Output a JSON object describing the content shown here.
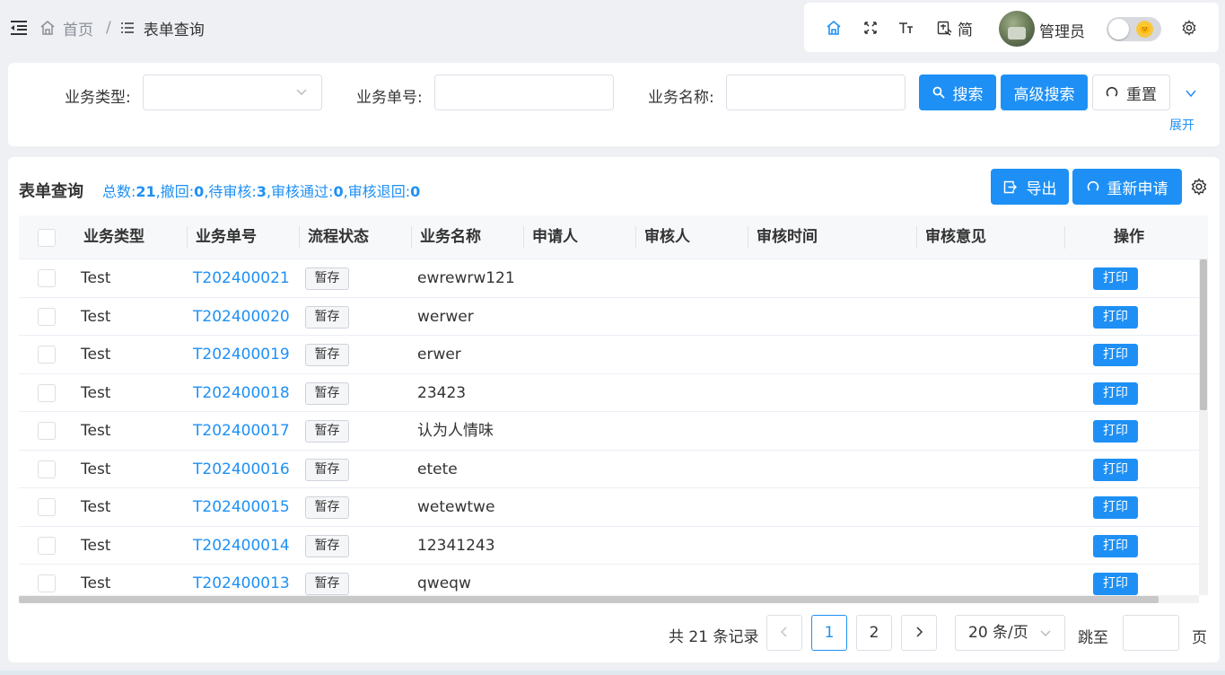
{
  "breadcrumb": {
    "home": "首页",
    "separator": "/",
    "current": "表单查询"
  },
  "toolbar": {
    "language": "简",
    "username": "管理员",
    "theme_emoji": "🌞"
  },
  "search": {
    "fields": [
      {
        "label": "业务类型:",
        "value": "",
        "placeholder": ""
      },
      {
        "label": "业务单号:",
        "value": "",
        "placeholder": ""
      },
      {
        "label": "业务名称:",
        "value": "",
        "placeholder": ""
      }
    ],
    "search_btn": "搜索",
    "advanced_btn": "高级搜索",
    "reset_btn": "重置",
    "expand_label": "展开"
  },
  "table_card": {
    "title": "表单查询",
    "stats": {
      "total_label": "总数:",
      "total": "21",
      "sep1": ",",
      "withdrawn_label": "撤回:",
      "withdrawn": "0",
      "sep2": ",",
      "pending_label": "待审核:",
      "pending": "3",
      "sep3": ",",
      "approved_label": "审核通过:",
      "approved": "0",
      "sep4": ",",
      "returned_label": "审核退回:",
      "returned": "0"
    },
    "export_btn": "导出",
    "reapply_btn": "重新申请",
    "columns": [
      "业务类型",
      "业务单号",
      "流程状态",
      "业务名称",
      "申请人",
      "审核人",
      "审核时间",
      "审核意见",
      "操作"
    ],
    "rows": [
      {
        "type": "Test",
        "no": "T202400021",
        "status": "暂存",
        "name": "ewrewrw121",
        "applicant": "",
        "reviewer": "",
        "review_time": "",
        "opinion": "",
        "action": "打印"
      },
      {
        "type": "Test",
        "no": "T202400020",
        "status": "暂存",
        "name": "werwer",
        "applicant": "",
        "reviewer": "",
        "review_time": "",
        "opinion": "",
        "action": "打印"
      },
      {
        "type": "Test",
        "no": "T202400019",
        "status": "暂存",
        "name": "erwer",
        "applicant": "",
        "reviewer": "",
        "review_time": "",
        "opinion": "",
        "action": "打印"
      },
      {
        "type": "Test",
        "no": "T202400018",
        "status": "暂存",
        "name": "23423",
        "applicant": "",
        "reviewer": "",
        "review_time": "",
        "opinion": "",
        "action": "打印"
      },
      {
        "type": "Test",
        "no": "T202400017",
        "status": "暂存",
        "name": "认为人情味",
        "applicant": "",
        "reviewer": "",
        "review_time": "",
        "opinion": "",
        "action": "打印"
      },
      {
        "type": "Test",
        "no": "T202400016",
        "status": "暂存",
        "name": "etete",
        "applicant": "",
        "reviewer": "",
        "review_time": "",
        "opinion": "",
        "action": "打印"
      },
      {
        "type": "Test",
        "no": "T202400015",
        "status": "暂存",
        "name": "wetewtwe",
        "applicant": "",
        "reviewer": "",
        "review_time": "",
        "opinion": "",
        "action": "打印"
      },
      {
        "type": "Test",
        "no": "T202400014",
        "status": "暂存",
        "name": "12341243",
        "applicant": "",
        "reviewer": "",
        "review_time": "",
        "opinion": "",
        "action": "打印"
      },
      {
        "type": "Test",
        "no": "T202400013",
        "status": "暂存",
        "name": "qweqw",
        "applicant": "",
        "reviewer": "",
        "review_time": "",
        "opinion": "",
        "action": "打印"
      }
    ]
  },
  "pagination": {
    "total_text": "共 21 条记录",
    "pages": [
      "1",
      "2"
    ],
    "current_page": "1",
    "page_size": "20 条/页",
    "jump_label": "跳至",
    "page_label": "页"
  },
  "colors": {
    "primary": "#1e90f5",
    "page_bg": "#eef0f3"
  }
}
